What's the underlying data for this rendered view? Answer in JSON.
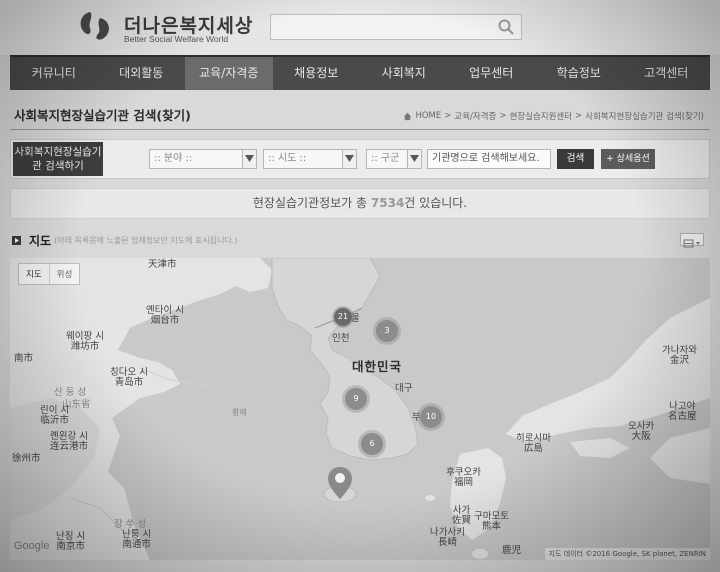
{
  "header": {
    "logo_korean": "더나은복지세상",
    "logo_english": "Better Social Welfare World",
    "search_placeholder": ""
  },
  "nav": {
    "items": [
      "커뮤니티",
      "대외활동",
      "교육/자격증",
      "채용정보",
      "사회복지",
      "업무센터",
      "학습정보",
      "고객센터"
    ],
    "active_index": 2
  },
  "page": {
    "title": "사회복지현장실습기관 검색(찾기)",
    "breadcrumb": [
      "HOME",
      "교육/자격증",
      "현장실습지원센터",
      "사회복지현장실습기관 검색(찾기)"
    ],
    "breadcrumb_sep": ">"
  },
  "search_panel": {
    "label": "사회복지현장실습기관 검색하기",
    "category_select": ":: 분야 ::",
    "province_select": ":: 시도 ::",
    "district_select": ":: 구군",
    "keyword_value": "기관명으로 검색해보세요.",
    "search_button": "검색",
    "detail_button": "+ 상세옵션"
  },
  "result": {
    "prefix": "현장실습기관정보가 총 ",
    "count": "7534",
    "suffix": "건 있습니다."
  },
  "map_section": {
    "title": "지도",
    "note": "(아래 목록몸에 노출된 업체정보만 지도에 표시됩니다.)"
  },
  "map": {
    "type_buttons": [
      "지도",
      "위성"
    ],
    "labels": {
      "tianjin": "天津市",
      "weihai": "웨이하이 시\n威海市",
      "yantai": "옌타이 시\n烟台市",
      "weifang": "웨이팡 시\n潍坊市",
      "qingdao": "칭다오 시\n青岛市",
      "jinan": "南市",
      "shandong": "산 둥 성",
      "shandong2": "山东省",
      "linyi": "린이 시\n临沂市",
      "lianyungang": "롄윈강 시\n连云港市",
      "xuzhou": "徐州市",
      "jiangsu": "장 쑤 성",
      "nantong": "난퉁 시\n南通市",
      "nanjing": "난징 시\n南京市",
      "yellow_sea": "황해",
      "seoul": "울",
      "incheon": "인천",
      "korea": "대한민국",
      "daegu": "대구",
      "busan": "부",
      "hiroshima": "히로시마\n広島",
      "osaka": "오사카\n大阪",
      "nagoya": "나고야\n名古屋",
      "kanazawa": "가나자와\n金沢",
      "fukuoka": "후쿠오카\n福岡",
      "kumamoto": "구마모토\n熊本",
      "saga": "사가\n佐賀",
      "nagasaki": "나가사키\n長崎",
      "kagoshima": "鹿児"
    },
    "clusters": [
      {
        "id": "c1",
        "count": "21"
      },
      {
        "id": "c2",
        "count": "3"
      },
      {
        "id": "c3",
        "count": "9"
      },
      {
        "id": "c4",
        "count": "10"
      },
      {
        "id": "c5",
        "count": "6"
      }
    ],
    "google": "Google",
    "attribution": "지도 데이터 ©2016 Google, SK planet, ZENRIN"
  },
  "colors": {
    "nav_bg": "#4a4a4a",
    "nav_active": "#6b6b6b",
    "land": "#e4e4e4",
    "korea_land": "#d8d8d8",
    "sea": "#c9c9c9"
  }
}
